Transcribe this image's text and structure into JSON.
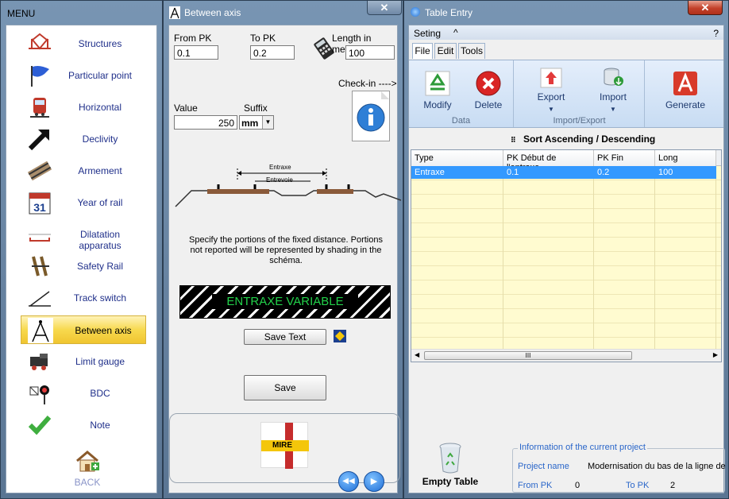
{
  "menu": {
    "title": "MENU",
    "items": [
      {
        "label": "Structures",
        "icon": "bridge-icon"
      },
      {
        "label": "Particular point",
        "icon": "flag-icon"
      },
      {
        "label": "Horizontal",
        "icon": "train-icon"
      },
      {
        "label": "Declivity",
        "icon": "arrow-up-right-icon"
      },
      {
        "label": "Armement",
        "icon": "rail-track-icon"
      },
      {
        "label": "Year of rail",
        "icon": "calendar-icon"
      },
      {
        "label": "Dilatation apparatus",
        "icon": "dilatation-icon"
      },
      {
        "label": "Safety Rail",
        "icon": "safety-rail-icon"
      },
      {
        "label": "Track switch",
        "icon": "track-switch-icon"
      },
      {
        "label": "Between axis",
        "icon": "compass-icon"
      },
      {
        "label": "Limit gauge",
        "icon": "locomotive-icon"
      },
      {
        "label": "BDC",
        "icon": "signal-icon"
      },
      {
        "label": "Note",
        "icon": "checkmark-icon"
      }
    ],
    "active_index": 9,
    "back_label": "BACK",
    "calendar_day": "31"
  },
  "axis": {
    "title": "Between axis",
    "from_pk_label": "From PK",
    "from_pk_value": "0.1",
    "to_pk_label": "To PK",
    "to_pk_value": "0.2",
    "length_label": "Length in meter",
    "length_value": "100",
    "checkin_label": "Check-in ---->",
    "value_label": "Value",
    "value": "250",
    "suffix_label": "Suffix",
    "suffix_value": "mm",
    "diagram_label_outer": "Entraxe",
    "diagram_label_inner": "Entrevoie",
    "instructions": "Specify the portions of the fixed distance. Portions not reported will be represented by shading in the schéma.",
    "banner_text": "ENTRAXE VARIABLE",
    "save_text_label": "Save Text",
    "save_label": "Save",
    "logo_text": "MIRE"
  },
  "table": {
    "title": "Table Entry",
    "menu_seting": "Seting",
    "menu_caret": "^",
    "menu_help": "?",
    "tabs": [
      "File",
      "Edit",
      "Tools"
    ],
    "active_tab": 0,
    "ribbon": {
      "modify": "Modify",
      "delete": "Delete",
      "group_data": "Data",
      "export": "Export",
      "import": "Import",
      "group_import_export": "Import/Export",
      "generate": "Generate"
    },
    "sort_label": "Sort Ascending / Descending",
    "columns": [
      "Type",
      "PK Début de l'entraxe",
      "PK Fin",
      "Long"
    ],
    "rows": [
      [
        "Entraxe",
        "0.1",
        "0.2",
        "100"
      ]
    ],
    "scroll_grip": "III",
    "empty_table_label": "Empty Table",
    "project": {
      "group_title": "Information of the current project",
      "project_name_label": "Project name",
      "project_name_value": "Modernisation du bas de la ligne de",
      "from_pk_label": "From PK",
      "from_pk_value": "0",
      "to_pk_label": "To PK",
      "to_pk_value": "2"
    }
  },
  "colors": {
    "link_blue": "#1f2f8a",
    "selection_blue": "#3399ff",
    "grid_yellow": "#fffbd0",
    "banner_green": "#22d14a",
    "ribbon_blue": "#cfe0f5"
  }
}
